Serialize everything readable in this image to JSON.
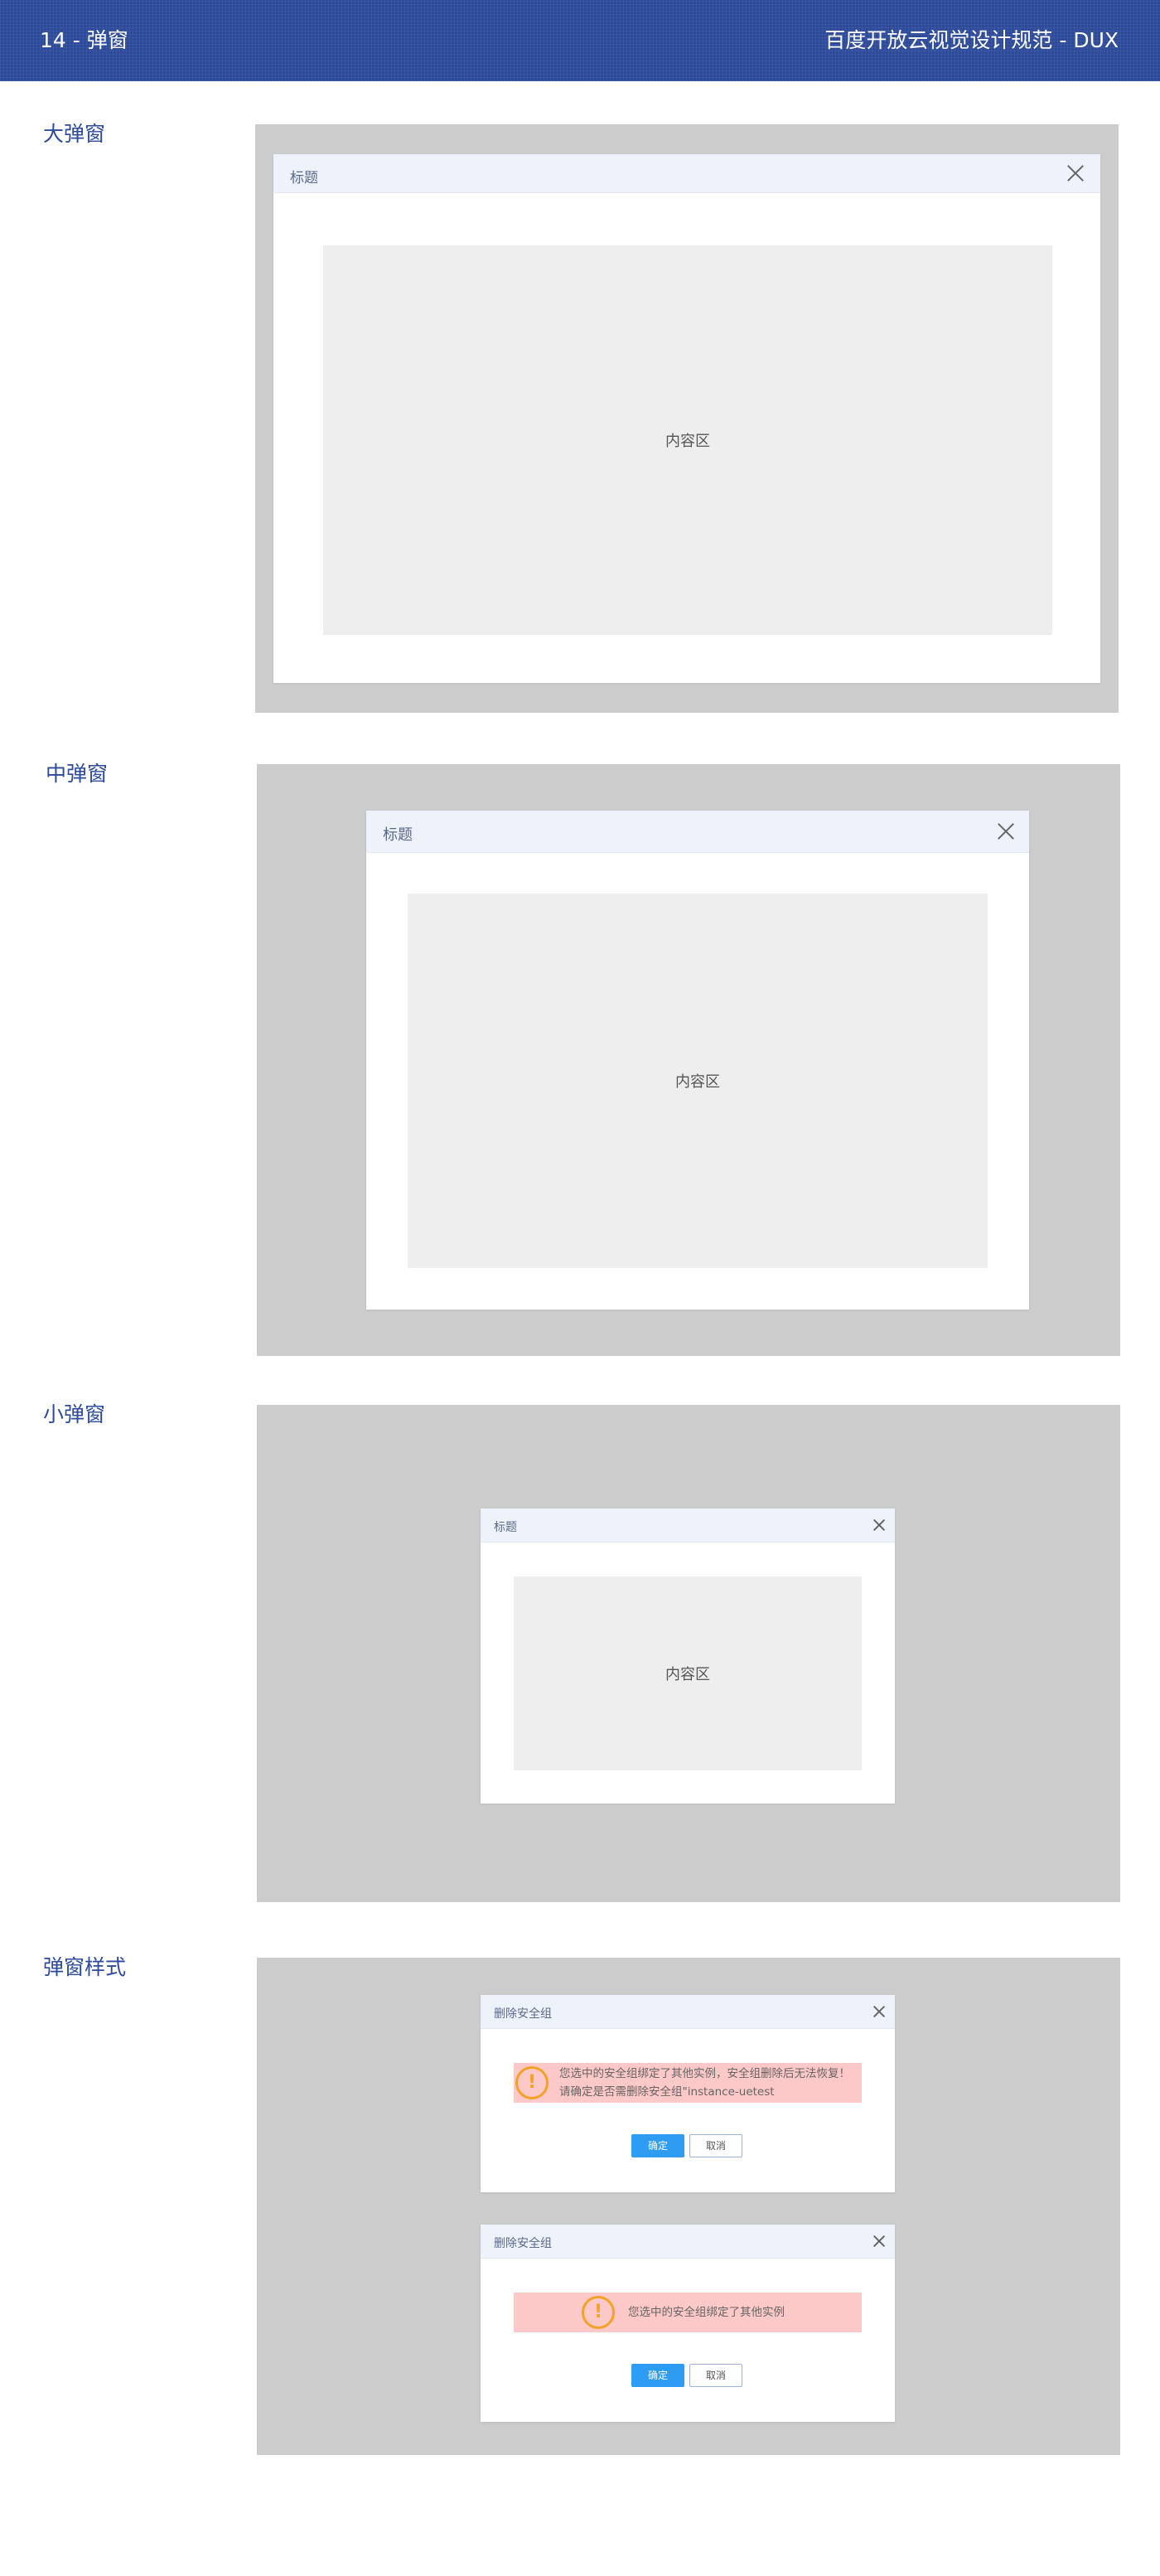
{
  "header": {
    "section_number": "14 - 弹窗",
    "spec_title": "百度开放云视觉设计规范 - DUX",
    "bg_color": "#2d4b9a"
  },
  "large": {
    "label": "大弹窗",
    "modal_title": "标题",
    "content_label": "内容区",
    "close_icon": "close-icon"
  },
  "medium": {
    "label": "中弹窗",
    "modal_title": "标题",
    "content_label": "内容区",
    "close_icon": "close-icon"
  },
  "small": {
    "label": "小弹窗",
    "modal_title": "标题",
    "content_label": "内容区",
    "close_icon": "close-icon"
  },
  "styles": {
    "label": "弹窗样式",
    "dialogs": [
      {
        "title": "删除安全组",
        "icon": "warning-icon",
        "message_lines": [
          "您选中的安全组绑定了其他实例，安全组删除后无法恢复！",
          "请确定是否需删除安全组\"instance-uetest"
        ],
        "confirm_label": "确定",
        "cancel_label": "取消"
      },
      {
        "title": "删除安全组",
        "icon": "warning-icon",
        "message_lines": [
          "您选中的安全组绑定了其他实例"
        ],
        "confirm_label": "确定",
        "cancel_label": "取消"
      }
    ]
  },
  "colors": {
    "overlay": "#cccccc",
    "modal_header": "#eef2fb",
    "content_area": "#eeeeee",
    "warning_bg": "#fdc8c8",
    "warning_icon": "#f2a327",
    "primary_button": "#2d9cf2"
  }
}
